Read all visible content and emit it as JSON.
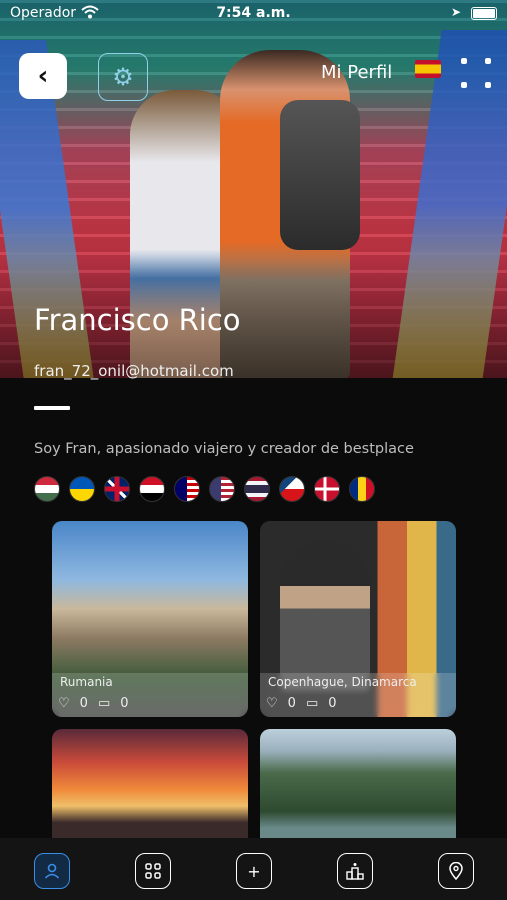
{
  "status_bar": {
    "carrier": "Operador",
    "time": "7:54 a.m."
  },
  "header": {
    "title": "Mi Perfil",
    "back_icon": "chevron-left-icon",
    "settings_icon": "gear-icon",
    "menu_icon": "grid-dots-icon",
    "language_flag": "spain-flag"
  },
  "profile": {
    "name": "Francisco Rico",
    "email": "fran_72_onil@hotmail.com",
    "bio": "Soy Fran, apasionado viajero y creador de bestplace",
    "flags": [
      "hungary",
      "ukraine",
      "united-kingdom",
      "egypt",
      "malaysia",
      "usa",
      "thailand",
      "czech-republic",
      "denmark",
      "romania"
    ]
  },
  "places": [
    {
      "name": "Rumania",
      "likes": "0",
      "comments": "0"
    },
    {
      "name": "Copenhague, Dinamarca",
      "likes": "0",
      "comments": "0"
    },
    {
      "name": "",
      "likes": "",
      "comments": ""
    },
    {
      "name": "",
      "likes": "",
      "comments": ""
    }
  ],
  "tabbar": {
    "items": [
      "profile-tab",
      "grid-tab",
      "add-tab",
      "ranking-tab",
      "map-tab"
    ],
    "active": "profile-tab",
    "active_color": "#3a8ee6"
  }
}
